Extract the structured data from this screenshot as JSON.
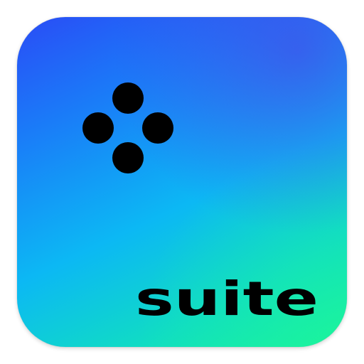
{
  "app_icon": {
    "wordmark": "suite",
    "logo_icon": "four-dots-icon",
    "colors": {
      "gradient_top": "#2a4cf6",
      "gradient_mid": "#0cb8f4",
      "gradient_bottom": "#18f0a0",
      "foreground": "#000000"
    }
  }
}
